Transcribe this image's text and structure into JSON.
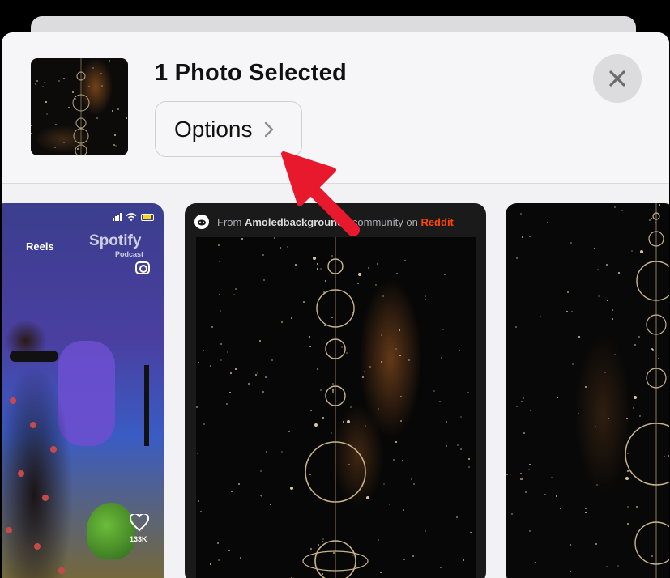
{
  "share_sheet": {
    "title": "1 Photo Selected",
    "options_label": "Options",
    "chevron_icon": "chevron-right-icon",
    "close_icon": "xmark-icon"
  },
  "cards": {
    "reels": {
      "reels_label": "Reels",
      "spotify_label": "Spotify",
      "podcast_label": "Podcast",
      "like_count": "133K"
    },
    "reddit": {
      "prefix": "From",
      "community": "Amoledbackgrounds",
      "middle": "community on",
      "site": "Reddit",
      "site_color": "#ff4500"
    }
  },
  "annotation": {
    "arrow_color": "#e8192c",
    "arrow_icon": "red-arrow-icon"
  }
}
